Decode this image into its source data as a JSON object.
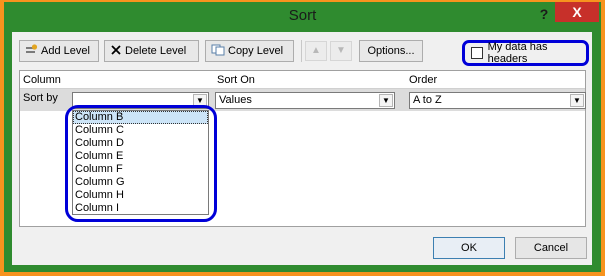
{
  "dialog": {
    "title": "Sort",
    "help_label": "?",
    "close_label": "X"
  },
  "toolbar": {
    "add_level_label": "Add Level",
    "delete_level_label": "Delete Level",
    "copy_level_label": "Copy Level",
    "move_up_glyph": "▲",
    "move_down_glyph": "▼",
    "options_label": "Options...",
    "headers_checkbox_label": "My data has headers",
    "headers_checked": false
  },
  "grid": {
    "column_header": "Column",
    "sort_on_header": "Sort On",
    "order_header": "Order",
    "row_label": "Sort by",
    "column_value": "",
    "sort_on_value": "Values",
    "order_value": "A to Z"
  },
  "column_dropdown": {
    "options": [
      "Column B",
      "Column C",
      "Column D",
      "Column E",
      "Column F",
      "Column G",
      "Column H",
      "Column I"
    ],
    "selected": "Column B"
  },
  "footer": {
    "ok_label": "OK",
    "cancel_label": "Cancel"
  },
  "colors": {
    "annotation_outline": "#0000d8",
    "frame": "#2f8b2f",
    "background": "#f7931e",
    "close_button": "#c7302a"
  }
}
